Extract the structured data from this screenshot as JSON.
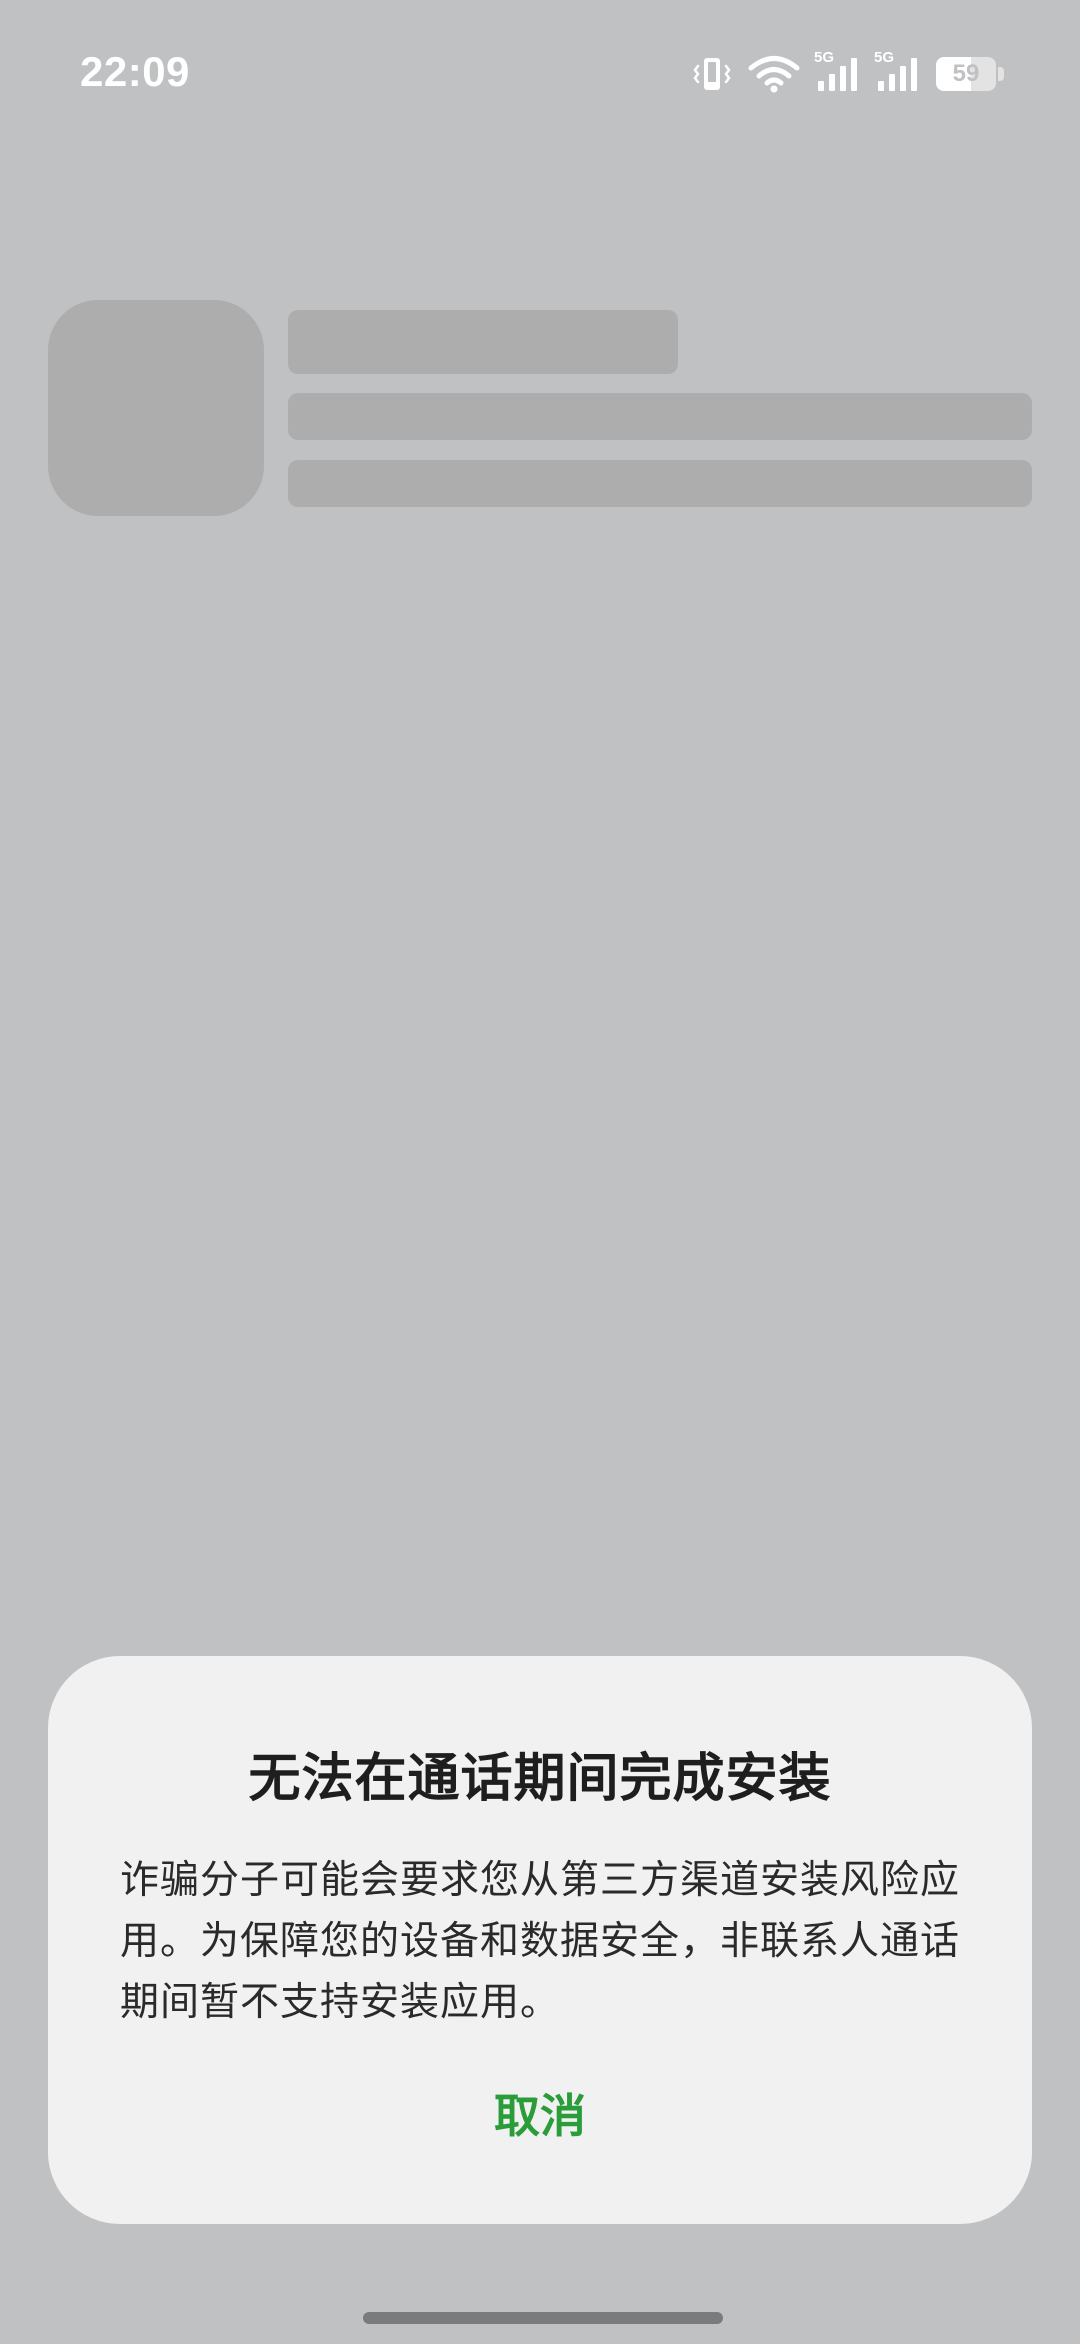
{
  "status_bar": {
    "time": "22:09",
    "network_1": "5G",
    "network_2": "5G",
    "battery_level": "59",
    "icons": [
      "vibrate-icon",
      "wifi-icon",
      "signal-icon",
      "signal-icon",
      "battery-icon"
    ]
  },
  "dialog": {
    "title": "无法在通话期间完成安装",
    "message": "诈骗分子可能会要求您从第三方渠道安装风险应用。为保障您的设备和数据安全，非联系人通话期间暂不支持安装应用。",
    "cancel_label": "取消"
  },
  "colors": {
    "background": "#c0c1c3",
    "dialog_background": "#f1f1f1",
    "accent": "#2a9d3a",
    "skeleton": "#adadad"
  }
}
